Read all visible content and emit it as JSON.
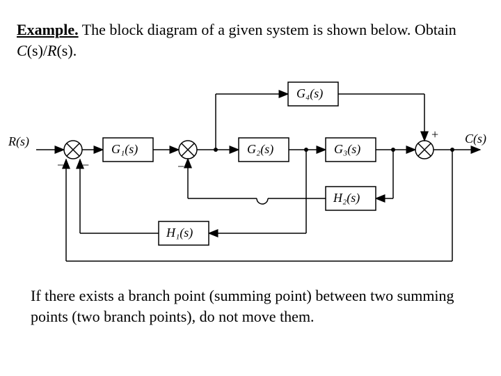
{
  "example_label": "Example.",
  "intro_text": " The block diagram of a given system is shown below. Obtain ",
  "tf_expr_c": "C",
  "tf_expr_r": "R",
  "tf_arg": "(s)",
  "period": ".",
  "footer_text": "If there exists a branch point (summing point) between two summing points (two branch points), do not move them.",
  "labels": {
    "R": "R(s)",
    "C": "C(s)",
    "G1": "G₁(s)",
    "G2": "G₂(s)",
    "G3": "G₃(s)",
    "G4": "G₄(s)",
    "H1": "H₁(s)",
    "H2": "H₂(s)",
    "plus": "+",
    "minus": "−"
  }
}
